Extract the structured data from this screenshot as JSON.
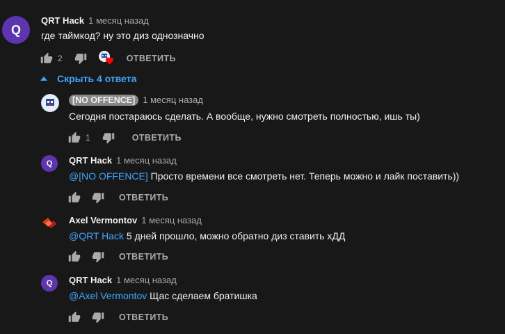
{
  "top_comment": {
    "avatar_letter": "Q",
    "author": "QRT Hack",
    "time": "1 месяц назад",
    "text": "где таймкод? ну это диз однозначно",
    "likes": "2",
    "reply_label": "ОТВЕТИТЬ"
  },
  "hide_replies_label": "Скрыть 4 ответа",
  "replies": [
    {
      "author": "[NO OFFENCE]",
      "time": "1 месяц назад",
      "text": "Сегодня постараюсь сделать. А вообще, нужно смотреть полностью, ишь ты)",
      "likes": "1",
      "reply_label": "ОТВЕТИТЬ"
    },
    {
      "avatar_letter": "Q",
      "author": "QRT Hack",
      "time": "1 месяц назад",
      "mention": "@[NO OFFENCE]",
      "text": " Просто времени все смотреть нет. Теперь можно и лайк поставить))",
      "reply_label": "ОТВЕТИТЬ"
    },
    {
      "author": "Axel Vermontov",
      "time": "1 месяц назад",
      "mention": "@QRT Hack",
      "text": " 5 дней прошло, можно обратно диз ставить хДД",
      "reply_label": "ОТВЕТИТЬ"
    },
    {
      "avatar_letter": "Q",
      "author": "QRT Hack",
      "time": "1 месяц назад",
      "mention": "@Axel Vermontov",
      "text": " Щас сделаем братишка",
      "reply_label": "ОТВЕТИТЬ"
    }
  ],
  "colors": {
    "background": "#181818",
    "link": "#3ea6ff",
    "avatar_q": "#5e35b1",
    "heart": "#ff0000"
  },
  "icons": [
    "thumb-up-icon",
    "thumb-down-icon",
    "heart-icon",
    "chevron-up-icon"
  ]
}
